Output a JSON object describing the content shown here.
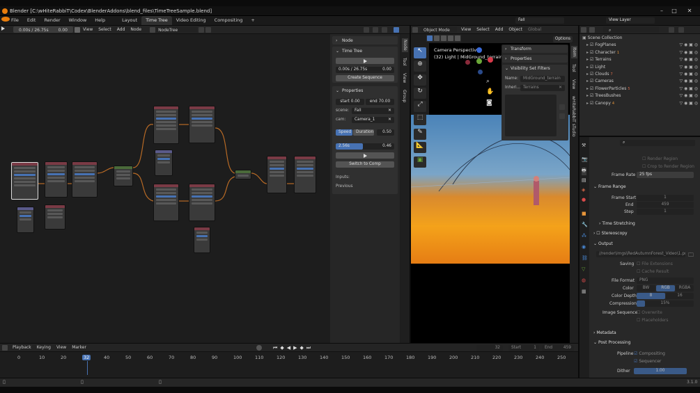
{
  "window": {
    "title": "Blender [C:\\wHiteRabbiT\\Codex\\BlenderAddons\\blend_files\\TimeTreeSample.blend]"
  },
  "menu": [
    "File",
    "Edit",
    "Render",
    "Window",
    "Help"
  ],
  "workspace_tabs": [
    "Layout",
    "Time Tree",
    "Video Editing",
    "Compositing",
    "+"
  ],
  "scene": {
    "name": "Fall",
    "view_layer": "View Layer"
  },
  "node_editor": {
    "timer": "0.00s / 26.75s",
    "frame": "0.00",
    "menus": [
      "View",
      "Select",
      "Add",
      "Node"
    ],
    "tree_name": "NodeTree"
  },
  "sidebar": {
    "node_label": "Node",
    "time_tree_label": "Time Tree",
    "time_display": "0.00s / 26.75s",
    "time_value": "0.00",
    "create_sequence": "Create Sequence",
    "properties_label": "Properties",
    "start": "start  0.00",
    "end": "end  70.00",
    "scene_label": "scene:",
    "scene_value": "Fall",
    "cam_label": "cam:",
    "cam_value": "Camera_1",
    "speed": "Speed",
    "duration": "Duration",
    "duration_value": "0.50",
    "progress_value": "2.56s",
    "progress_right": "0.46",
    "progress_fraction": 0.46,
    "switch_to_comp": "Switch to Comp",
    "inputs": "Inputs:",
    "previous": "Previous",
    "tabs": [
      "Node",
      "Tool",
      "View",
      "Group"
    ]
  },
  "viewport": {
    "mode": "Object Mode",
    "menus": [
      "View",
      "Select",
      "Add",
      "Object"
    ],
    "orientation": "Global",
    "overlay_title": "Camera Perspective",
    "overlay_sub": "(32) Light | MidGround_terrain",
    "options": "Options",
    "n_panel": {
      "transform": "Transform",
      "properties": "Properties",
      "vis_filters": "Visibility Set Filters",
      "name_label": "Name:",
      "name_value": "MidGround_terrain",
      "inherit_label": "Inheri...",
      "inherit_value": "Terrains"
    },
    "tabs": [
      "Item",
      "Tool",
      "View",
      "wHiteRabbiT sTudio"
    ]
  },
  "outliner": {
    "root": "Scene Collection",
    "items": [
      "FogPlanes",
      "Character",
      "Terrains",
      "Light",
      "Clouds",
      "Cameras",
      "FlowerParticles",
      "TreesBushes",
      "Canopy"
    ],
    "counts": [
      "",
      "1",
      "",
      "",
      "7",
      "",
      "5",
      "",
      "4"
    ]
  },
  "props": {
    "render_region": "Render Region",
    "crop_region": "Crop to Render Region",
    "frame_rate_label": "Frame Rate",
    "frame_rate": "25 fps",
    "frame_range": "Frame Range",
    "frame_start_label": "Frame Start",
    "frame_start": "1",
    "end_label": "End",
    "end": "459",
    "step_label": "Step",
    "step": "1",
    "time_stretching": "Time Stretching",
    "stereoscopy": "Stereoscopy",
    "output": "Output",
    "output_path": "//render\\Imgs\\RedAutumnForest_Video\\1.png",
    "saving": "Saving",
    "file_ext": "File Extensions",
    "cache": "Cache Result",
    "file_format_label": "File Format",
    "file_format": "PNG",
    "color_label": "Color",
    "color_opts": [
      "BW",
      "RGB",
      "RGBA"
    ],
    "color_depth_label": "Color Depth",
    "color_depth": [
      "8",
      "16"
    ],
    "compression_label": "Compression",
    "compression": "15%",
    "img_seq_label": "Image Sequence",
    "overwrite": "Overwrite",
    "placeholders": "Placeholders",
    "metadata": "Metadata",
    "post_processing": "Post Processing",
    "pipeline_label": "Pipeline",
    "compositing": "Compositing",
    "sequencer": "Sequencer",
    "dither_label": "Dither",
    "dither": "1.00"
  },
  "timeline": {
    "menus": [
      "Playback",
      "Keying",
      "View",
      "Marker"
    ],
    "current": "32",
    "start_label": "Start",
    "start": "1",
    "end_label": "End",
    "end": "459",
    "ticks": [
      "0",
      "10",
      "20",
      "32",
      "40",
      "50",
      "60",
      "70",
      "80",
      "90",
      "100",
      "110",
      "120",
      "130",
      "140",
      "150",
      "160",
      "170",
      "180",
      "190",
      "200",
      "210",
      "220",
      "230",
      "240",
      "250"
    ]
  },
  "status": {
    "version": "3.1.0"
  }
}
